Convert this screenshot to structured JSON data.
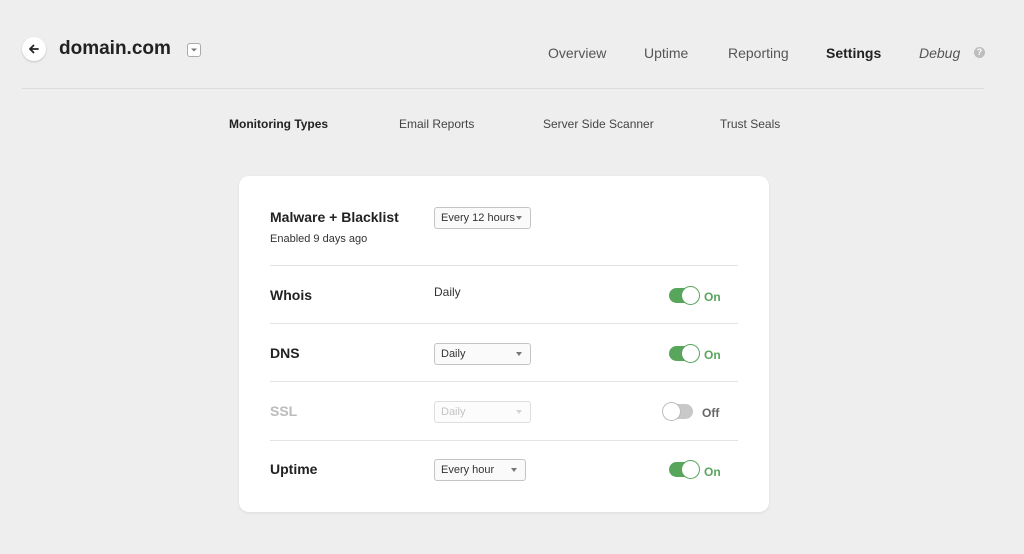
{
  "header": {
    "site_title": "domain.com",
    "nav": [
      {
        "label": "Overview",
        "active": false
      },
      {
        "label": "Uptime",
        "active": false
      },
      {
        "label": "Reporting",
        "active": false
      },
      {
        "label": "Settings",
        "active": true
      },
      {
        "label": "Debug",
        "active": false
      }
    ],
    "help_glyph": "?"
  },
  "subnav": [
    {
      "label": "Monitoring Types",
      "active": true
    },
    {
      "label": "Email Reports",
      "active": false
    },
    {
      "label": "Server Side Scanner",
      "active": false
    },
    {
      "label": "Trust Seals",
      "active": false
    }
  ],
  "monitoring": {
    "malware": {
      "title": "Malware + Blacklist",
      "subtitle": "Enabled 9 days ago",
      "frequency": "Every 12 hours"
    },
    "whois": {
      "title": "Whois",
      "frequency": "Daily",
      "toggle_label": "On",
      "enabled": true
    },
    "dns": {
      "title": "DNS",
      "frequency": "Daily",
      "toggle_label": "On",
      "enabled": true
    },
    "ssl": {
      "title": "SSL",
      "frequency": "Daily",
      "toggle_label": "Off",
      "enabled": false
    },
    "uptime": {
      "title": "Uptime",
      "frequency": "Every hour",
      "toggle_label": "On",
      "enabled": true
    }
  },
  "colors": {
    "background": "#eeeeee",
    "card": "#ffffff",
    "toggle_on": "#58a65c",
    "toggle_off": "#c8c8c8"
  },
  "icons": {
    "back": "arrow-left-icon",
    "site_dropdown": "chevron-down-icon",
    "help": "question-circle-icon",
    "select_caret": "caret-down-icon"
  }
}
